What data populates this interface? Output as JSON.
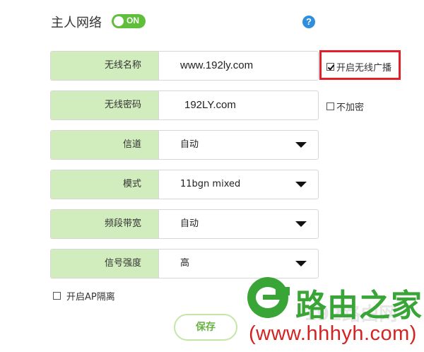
{
  "header": {
    "title": "主人网络",
    "toggle_label": "ON",
    "help_label": "?"
  },
  "fields": {
    "ssid": {
      "label": "无线名称",
      "value": "www.192ly.com"
    },
    "password": {
      "label": "无线密码",
      "value": "192LY.com"
    },
    "channel": {
      "label": "信道",
      "value": "自动"
    },
    "mode": {
      "label": "模式",
      "value": "11bgn mixed"
    },
    "bandwidth": {
      "label": "频段带宽",
      "value": "自动"
    },
    "signal": {
      "label": "信号强度",
      "value": "高"
    }
  },
  "options": {
    "broadcast": {
      "label": "开启无线广播",
      "checked": true
    },
    "no_encrypt": {
      "label": "不加密",
      "checked": false
    },
    "ap_isolation": {
      "label": "开启AP隔离",
      "checked": false
    }
  },
  "actions": {
    "save_label": "保存"
  },
  "watermark": {
    "brand": "路由之家",
    "url": "(www.hhhyh.com)",
    "faint": "192路由网"
  },
  "colors": {
    "label_bg": "#d2edbd",
    "toggle": "#5fbf3a",
    "help": "#2f8fde",
    "highlight": "#e3202a",
    "brand": "#3aa537",
    "url": "#d32323"
  }
}
